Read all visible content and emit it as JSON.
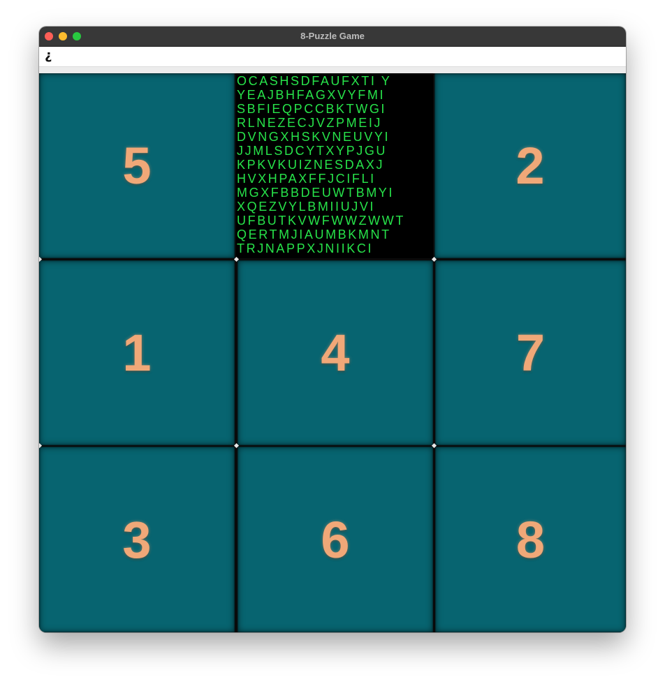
{
  "window": {
    "title": "8-Puzzle Game"
  },
  "menubar": {
    "item_label": "¿"
  },
  "board": {
    "tiles": [
      "5",
      "",
      "2",
      "1",
      "4",
      "7",
      "3",
      "6",
      "8"
    ],
    "empty_tile_text": [
      "OCASHSDFAUFXTI Y",
      "YEAJBHFAGXVYFMI",
      "SBFIEQPCCBKTWGI",
      "RLNEZECJVZPMEIJ",
      "DVNGXHSKVNEUVYI",
      "JJMLSDCYTXYPJGU",
      "KPKVKUIZNESDAXJ",
      "HVXHPAXFFJCIFLI",
      "MGXFBBDEUWTBMYI",
      "XQEZVYLBMIIUJVI",
      "UFBUTKVWFWWZWWT",
      "QERTMJIAUMBKMNT",
      "TRJNAPPXJNIIKCI"
    ]
  },
  "colors": {
    "tile_background": "#076470",
    "tile_number": "#f0a878",
    "empty_tile_background": "#000000",
    "empty_tile_text": "#27e34a",
    "titlebar": "#383838"
  }
}
